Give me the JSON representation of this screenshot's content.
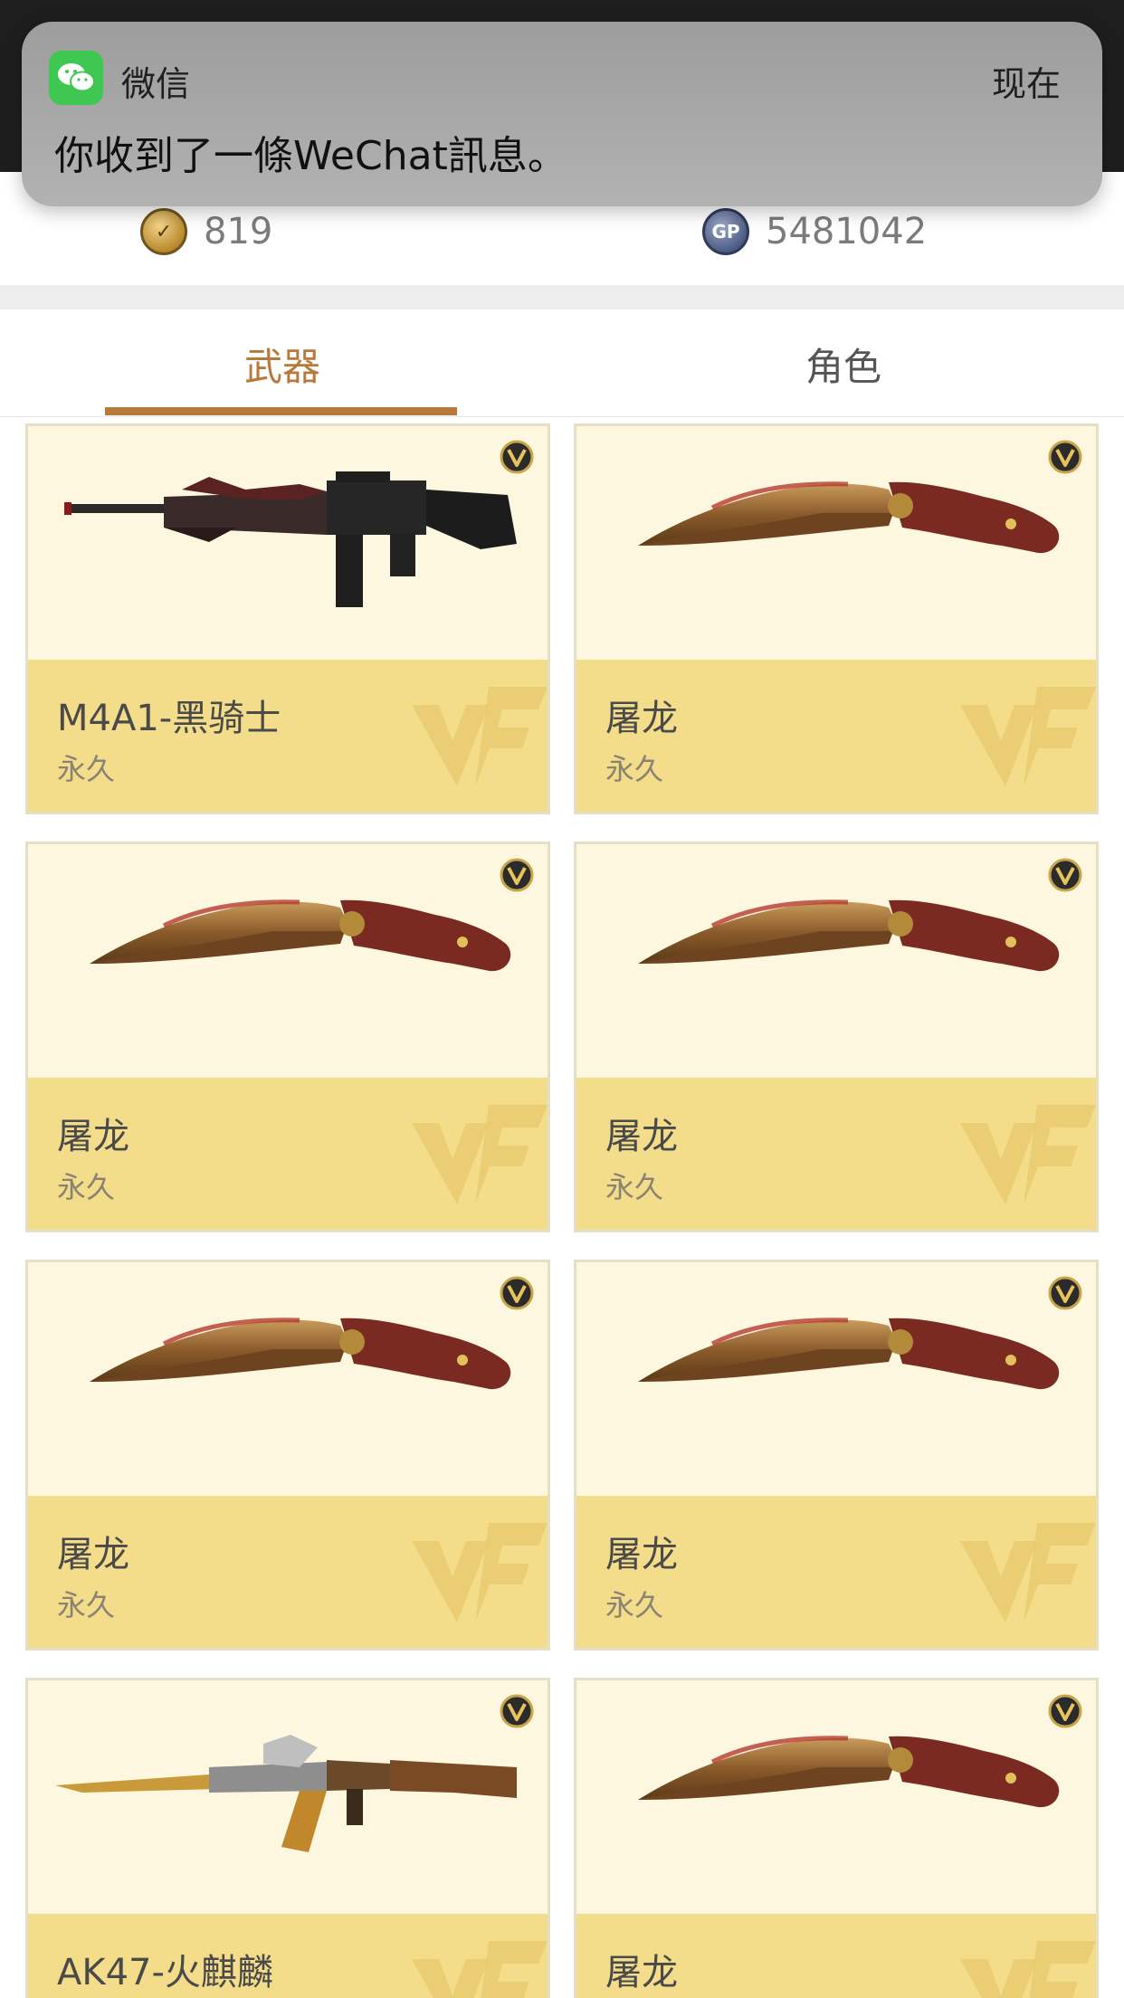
{
  "notification": {
    "app_icon": "wechat-icon",
    "app_name": "微信",
    "time": "现在",
    "message": "你收到了一條WeChat訊息。"
  },
  "currency": {
    "cf_points": "819",
    "gp": "5481042"
  },
  "tabs": [
    {
      "label": "武器",
      "active": true
    },
    {
      "label": "角色",
      "active": false
    }
  ],
  "colors": {
    "accent": "#b8793a",
    "card_bg": "#fdf7e0",
    "card_info_bg": "#f3dd8a"
  },
  "items": [
    {
      "name": "M4A1-黑骑士",
      "duration": "永久",
      "weapon": "rifle-m4a1",
      "badge": "v-badge-icon"
    },
    {
      "name": "屠龙",
      "duration": "永久",
      "weapon": "kukri-knife",
      "badge": "v-badge-icon"
    },
    {
      "name": "屠龙",
      "duration": "永久",
      "weapon": "kukri-knife",
      "badge": "v-badge-icon"
    },
    {
      "name": "屠龙",
      "duration": "永久",
      "weapon": "kukri-knife",
      "badge": "v-badge-icon"
    },
    {
      "name": "屠龙",
      "duration": "永久",
      "weapon": "kukri-knife",
      "badge": "v-badge-icon"
    },
    {
      "name": "屠龙",
      "duration": "永久",
      "weapon": "kukri-knife",
      "badge": "v-badge-icon"
    },
    {
      "name": "AK47-火麒麟",
      "duration": "",
      "weapon": "rifle-ak47",
      "badge": "v-badge-icon"
    },
    {
      "name": "屠龙",
      "duration": "",
      "weapon": "kukri-knife",
      "badge": "v-badge-icon"
    }
  ]
}
